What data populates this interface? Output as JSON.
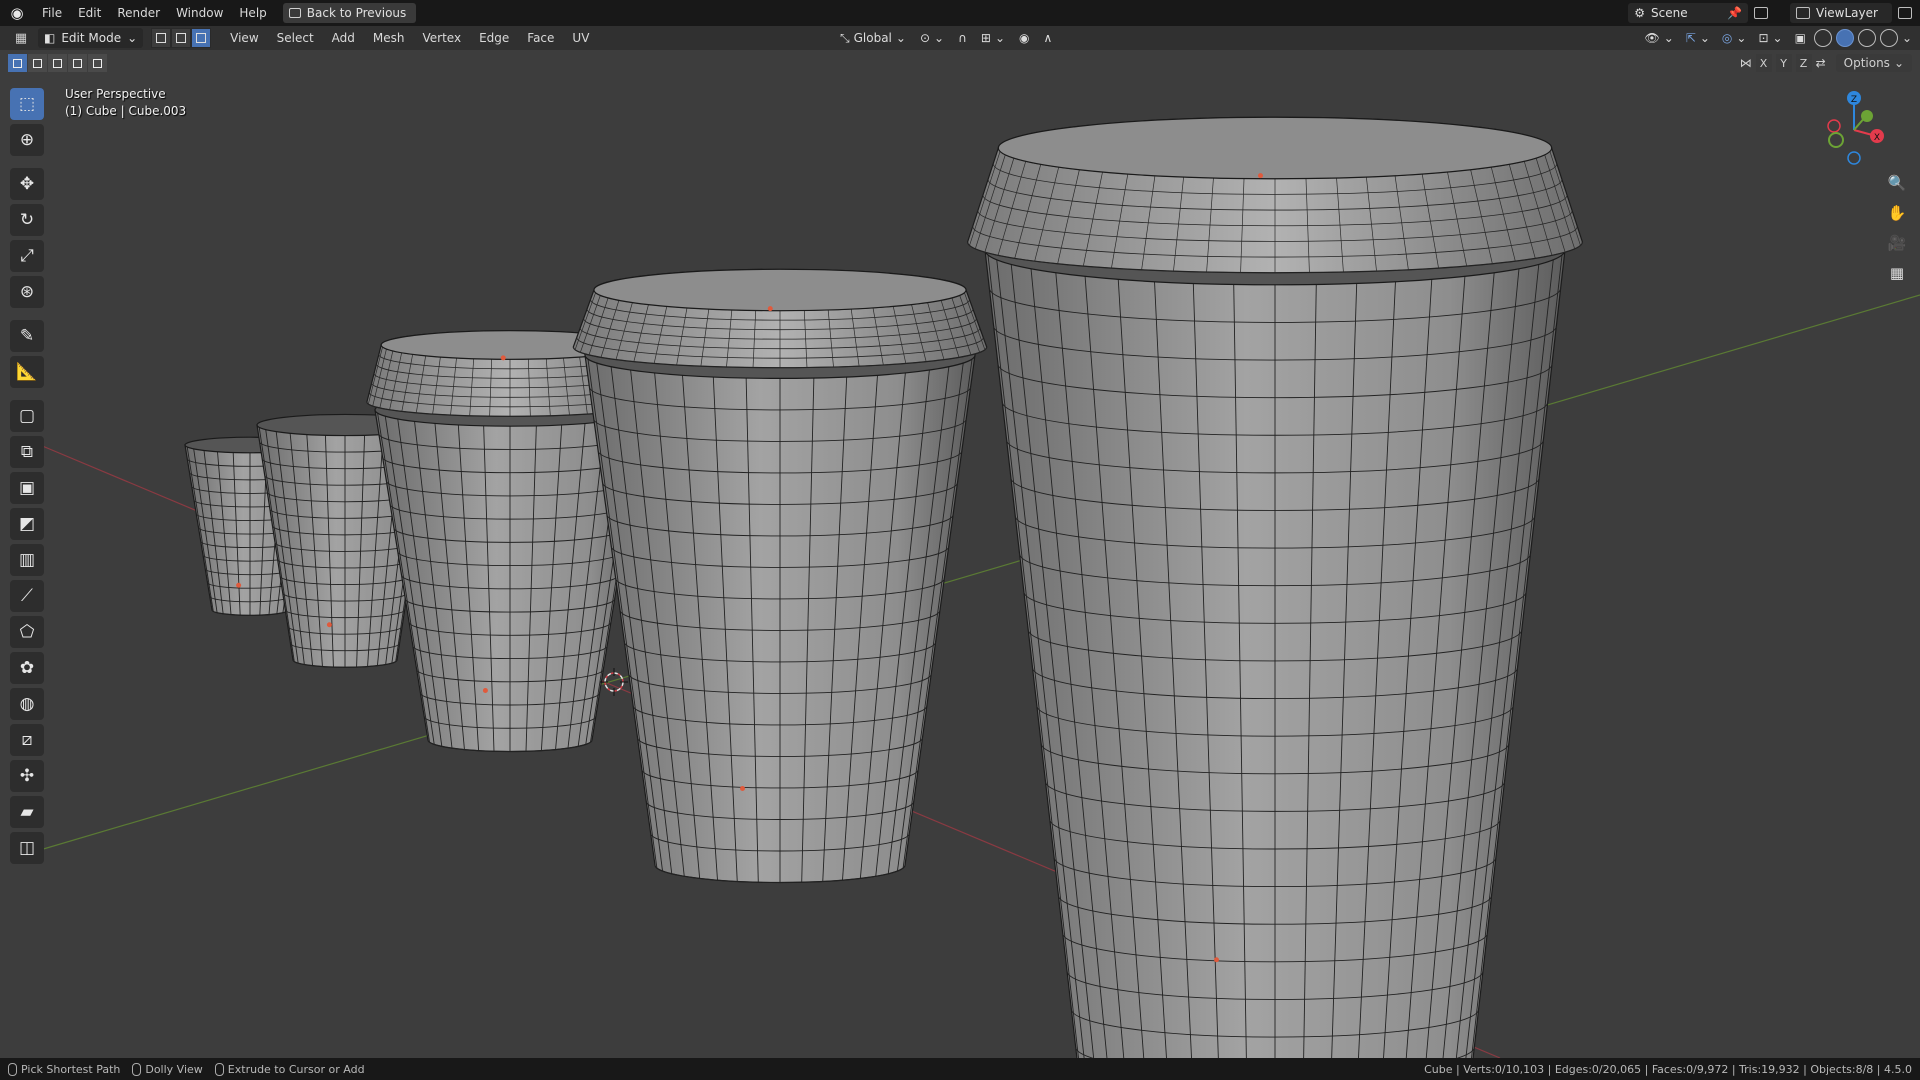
{
  "app": {
    "menu": [
      "File",
      "Edit",
      "Render",
      "Window",
      "Help"
    ],
    "back_button": "Back to Previous",
    "scene_name": "Scene",
    "view_layer": "ViewLayer"
  },
  "header": {
    "mode": "Edit Mode",
    "menu": [
      "View",
      "Select",
      "Add",
      "Mesh",
      "Vertex",
      "Edge",
      "Face",
      "UV"
    ],
    "transform_orientation": "Global",
    "options_label": "Options",
    "axes": [
      "X",
      "Y",
      "Z"
    ]
  },
  "overlay": {
    "view_name": "User Perspective",
    "object_info": "(1) Cube | Cube.003"
  },
  "gizmo": {
    "z_label": "Z",
    "x_label": "X",
    "colors": {
      "x": "#e33b4c",
      "y": "#6ca335",
      "z": "#2e87dd"
    }
  },
  "statusbar": {
    "hints": [
      "Pick Shortest Path",
      "Dolly View",
      "Extrude to Cursor or Add"
    ],
    "stats": "Cube | Verts:0/10,103 | Edges:0/20,065 | Faces:0/9,972 | Tris:19,932 | Objects:8/8 | 4.5.0"
  },
  "tools": [
    "select-box",
    "cursor",
    "move",
    "rotate",
    "scale",
    "transform",
    "annotate",
    "measure",
    "add-cube",
    "extrude-region",
    "inset-faces",
    "bevel",
    "loop-cut",
    "knife",
    "poly-build",
    "spin",
    "smooth",
    "edge-slide",
    "shrink-fatten",
    "shear",
    "rip-region"
  ]
}
